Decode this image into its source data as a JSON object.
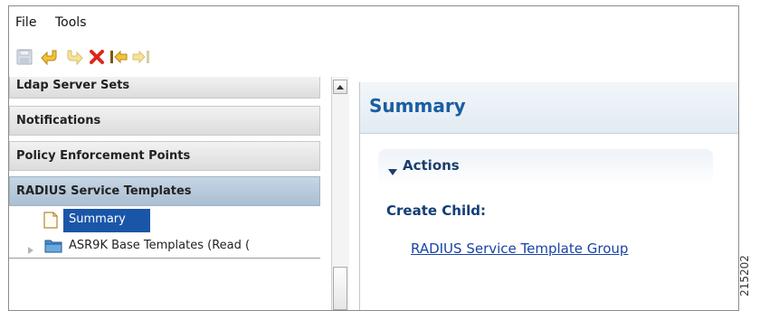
{
  "menubar": {
    "items": [
      "File",
      "Tools"
    ]
  },
  "toolbar": {
    "buttons": [
      {
        "name": "save-icon",
        "enabled": false
      },
      {
        "name": "undo-icon",
        "enabled": true
      },
      {
        "name": "redo-icon",
        "enabled": false
      },
      {
        "name": "delete-icon",
        "enabled": true
      },
      {
        "name": "back-icon",
        "enabled": true
      },
      {
        "name": "forward-icon",
        "enabled": false
      }
    ]
  },
  "left_panel": {
    "headers": [
      "Ldap Server Sets",
      "Notifications",
      "Policy Enforcement Points",
      "RADIUS Service Templates"
    ],
    "tree": {
      "summary_label": "Summary",
      "folder_label": "ASR9K Base Templates (Read ("
    }
  },
  "right_panel": {
    "title": "Summary",
    "actions_label": "Actions",
    "create_child_label": "Create Child:",
    "link_label": "RADIUS Service Template Group"
  },
  "side_code": "215202",
  "colors": {
    "title_blue": "#1a5ea0",
    "selection_blue": "#1a56a8",
    "link_blue": "#1a43a8"
  }
}
